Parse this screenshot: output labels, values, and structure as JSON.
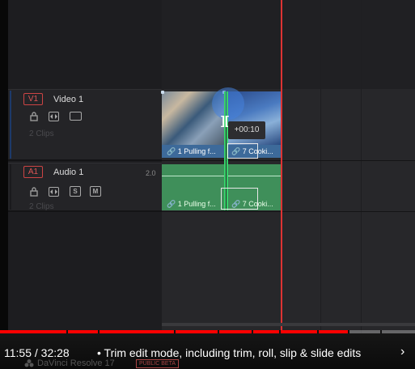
{
  "tracks": {
    "video": {
      "badge": "V1",
      "name": "Video 1",
      "clips_count": "2 Clips"
    },
    "audio": {
      "badge": "A1",
      "name": "Audio 1",
      "channels": "2.0",
      "clips_count": "2 Clips",
      "solo": "S",
      "mute": "M"
    }
  },
  "clips": {
    "video_1_label": "1 Pulling f...",
    "video_2_label": "7 Cooki...",
    "audio_1_label": "1 Pulling f...",
    "audio_2_label": "7 Cooki..."
  },
  "trim": {
    "tooltip": "+00:10",
    "bracket": "]["
  },
  "icons": {
    "link": "🔗",
    "lock": "lock-icon",
    "eye": "eye-icon",
    "monitor": "monitor-icon"
  },
  "player": {
    "time": "11:55 / 32:28",
    "chapter": "• Trim edit mode, including trim, roll, slip & slide edits",
    "chevron": "›",
    "progress_fraction": 0.84
  },
  "branding": {
    "app": "DaVinci Resolve 17",
    "badge": "PUBLIC BETA"
  },
  "colors": {
    "playhead": "#dd3333",
    "trim_line": "#36d36a",
    "audio_clip": "#3f8f5a",
    "video_label": "#3d6a9a",
    "progress": "#ff0000"
  }
}
